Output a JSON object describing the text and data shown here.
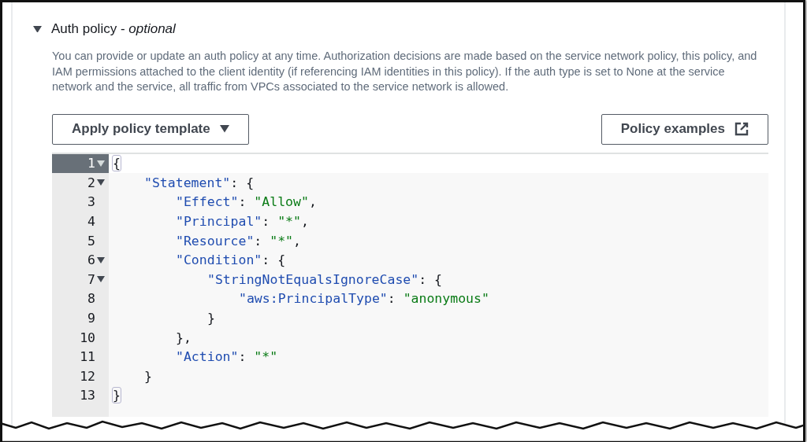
{
  "section": {
    "expanded": true,
    "title": "Auth policy - *optional*",
    "description": "You can provide or update an auth policy at any time. Authorization decisions are made based on the service network policy, this policy, and IAM permissions attached to the client identity (if referencing IAM identities in this policy). If the auth type is set to None at the service network and the service, all traffic from VPCs associated to the service network is allowed."
  },
  "buttons": [
    {
      "kind": "dropdown",
      "label": "Apply policy template"
    },
    {
      "kind": "external",
      "label": "Policy examples"
    }
  ],
  "editor": {
    "lines": [
      {
        "number": "1",
        "foldable": true,
        "selected": true,
        "tokens": [
          {
            "kind": "matched-bracket",
            "text": "{"
          }
        ]
      },
      {
        "number": "2",
        "foldable": true,
        "selected": false,
        "tokens": [
          {
            "kind": "key",
            "text": "\"Statement\""
          },
          {
            "kind": "punct",
            "text": ": {"
          }
        ]
      },
      {
        "number": "3",
        "foldable": false,
        "selected": false,
        "tokens": [
          {
            "kind": "key",
            "text": "\"Effect\""
          },
          {
            "kind": "punct",
            "text": ": "
          },
          {
            "kind": "string",
            "text": "\"Allow\""
          },
          {
            "kind": "punct",
            "text": ","
          }
        ]
      },
      {
        "number": "4",
        "foldable": false,
        "selected": false,
        "tokens": [
          {
            "kind": "key",
            "text": "\"Principal\""
          },
          {
            "kind": "punct",
            "text": ": "
          },
          {
            "kind": "string",
            "text": "\"*\""
          },
          {
            "kind": "punct",
            "text": ","
          }
        ]
      },
      {
        "number": "5",
        "foldable": false,
        "selected": false,
        "tokens": [
          {
            "kind": "key",
            "text": "\"Resource\""
          },
          {
            "kind": "punct",
            "text": ": "
          },
          {
            "kind": "string",
            "text": "\"*\""
          },
          {
            "kind": "punct",
            "text": ","
          }
        ]
      },
      {
        "number": "6",
        "foldable": true,
        "selected": false,
        "tokens": [
          {
            "kind": "key",
            "text": "\"Condition\""
          },
          {
            "kind": "punct",
            "text": ": {"
          }
        ]
      },
      {
        "number": "7",
        "foldable": true,
        "selected": false,
        "tokens": [
          {
            "kind": "key",
            "text": "\"StringNotEqualsIgnoreCase\""
          },
          {
            "kind": "punct",
            "text": ": {"
          }
        ]
      },
      {
        "number": "8",
        "foldable": false,
        "selected": false,
        "tokens": [
          {
            "kind": "key",
            "text": "\"aws:PrincipalType\""
          },
          {
            "kind": "punct",
            "text": ": "
          },
          {
            "kind": "string",
            "text": "\"anonymous\""
          }
        ]
      },
      {
        "number": "9",
        "foldable": false,
        "selected": false,
        "tokens": [
          {
            "kind": "punct",
            "text": "}"
          }
        ]
      },
      {
        "number": "10",
        "foldable": false,
        "selected": false,
        "tokens": [
          {
            "kind": "punct",
            "text": "},"
          }
        ]
      },
      {
        "number": "11",
        "foldable": false,
        "selected": false,
        "tokens": [
          {
            "kind": "key",
            "text": "\"Action\""
          },
          {
            "kind": "punct",
            "text": ": "
          },
          {
            "kind": "string",
            "text": "\"*\""
          }
        ]
      },
      {
        "number": "12",
        "foldable": false,
        "selected": false,
        "tokens": [
          {
            "kind": "punct",
            "text": "}"
          }
        ]
      },
      {
        "number": "13",
        "foldable": false,
        "selected": false,
        "tokens": [
          {
            "kind": "matched-bracket",
            "text": "}"
          }
        ]
      }
    ]
  }
}
